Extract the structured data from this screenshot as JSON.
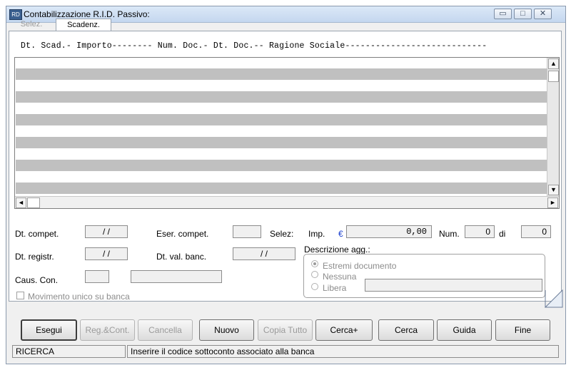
{
  "window": {
    "title": "Contabilizzazione R.I.D. Passivo:",
    "icon_glyph": "RD",
    "controls": {
      "minimize": "▭",
      "maximize": "□",
      "close": "✕"
    }
  },
  "tabs": [
    {
      "label": "Selez.",
      "active": false
    },
    {
      "label": "Scadenz.",
      "active": true
    }
  ],
  "list": {
    "header": "Dt. Scad.- Importo-------- Num. Doc.- Dt. Doc.-- Ragione Sociale----------------------------",
    "rows": [
      "",
      "",
      "",
      "",
      "",
      ""
    ],
    "scroll_icons": {
      "up": "▲",
      "down": "▼",
      "left": "◄",
      "right": "►"
    }
  },
  "form": {
    "dt_compet": {
      "label": "Dt. compet.",
      "value": "/   /"
    },
    "eser_compet": {
      "label": "Eser. compet.",
      "value": ""
    },
    "selez": {
      "label": "Selez:"
    },
    "imp": {
      "label": "Imp.",
      "currency": "€",
      "value": "0,00"
    },
    "num": {
      "label": "Num.",
      "value": "0"
    },
    "di": {
      "label": "di",
      "value": "0"
    },
    "dt_registr": {
      "label": "Dt. registr.",
      "value": "/   /"
    },
    "dt_val_banc": {
      "label": "Dt. val. banc.",
      "value": "/   /"
    },
    "descrizione": {
      "label": "Descrizione agg.:",
      "options": [
        "Estremi documento",
        "Nessuna",
        "Libera"
      ],
      "selected": "Estremi documento",
      "libera_value": ""
    },
    "caus_con": {
      "label": "Caus. Con.",
      "code": "",
      "desc": ""
    },
    "movimento_unico": {
      "label": "Movimento unico su banca",
      "checked": false
    }
  },
  "buttons": {
    "esegui": "Esegui",
    "reg_cont": "Reg.&Cont.",
    "cancella": "Cancella",
    "nuovo": "Nuovo",
    "copia_tutto": "Copia Tutto",
    "cerca_plus": "Cerca+",
    "cerca": "Cerca",
    "guida": "Guida",
    "fine": "Fine"
  },
  "status": {
    "mode": "RICERCA",
    "message": "Inserire il codice sottoconto associato alla banca"
  }
}
